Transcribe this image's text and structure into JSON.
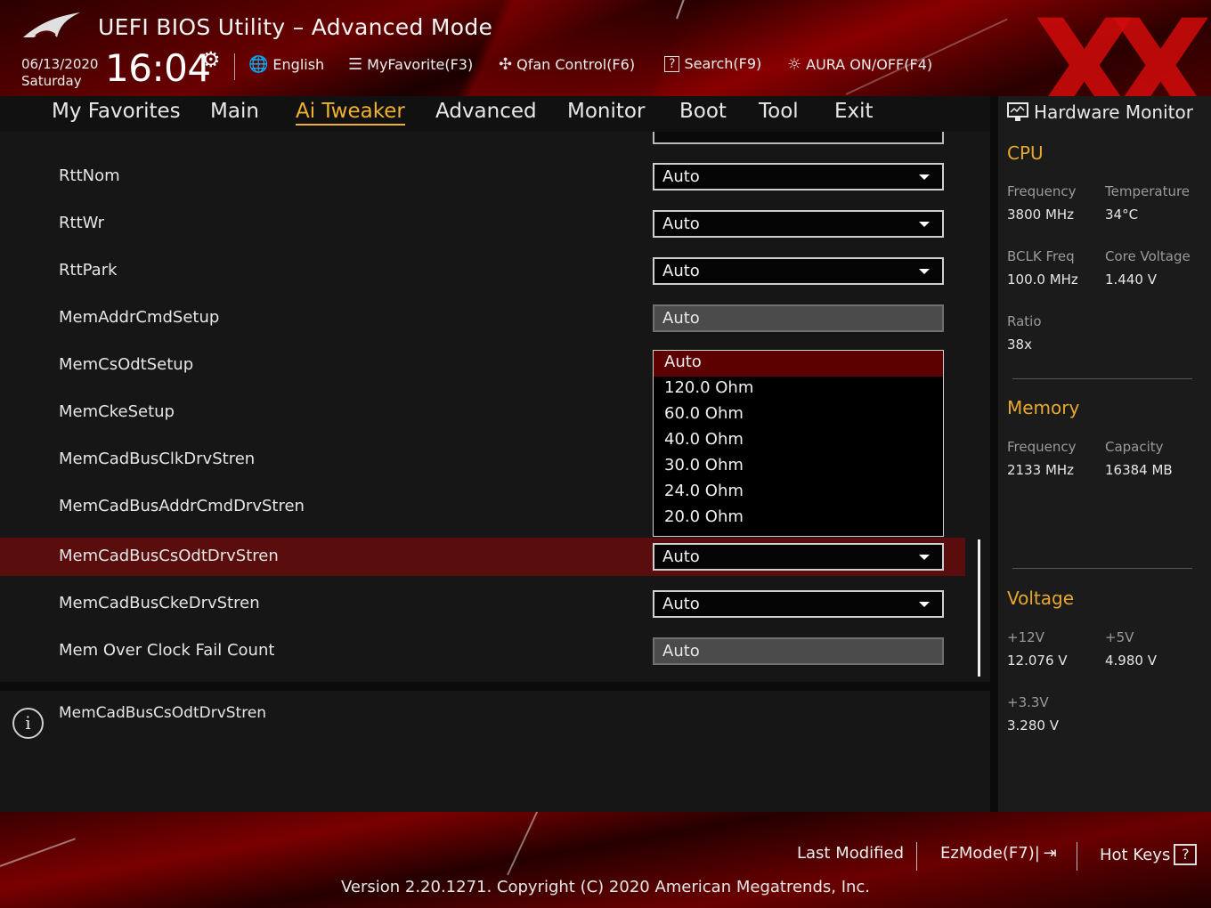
{
  "header": {
    "title": "UEFI BIOS Utility – Advanced Mode",
    "date": "06/13/2020",
    "day": "Saturday",
    "time": "16:04",
    "toolbar": [
      {
        "label": "English",
        "icon": "globe-icon"
      },
      {
        "label": "MyFavorite(F3)",
        "icon": "favorite-list-icon"
      },
      {
        "label": "Qfan Control(F6)",
        "icon": "fan-icon"
      },
      {
        "label": "Search(F9)",
        "icon": "search-help-icon"
      },
      {
        "label": "AURA ON/OFF(F4)",
        "icon": "aura-light-icon"
      }
    ]
  },
  "nav": {
    "tabs": [
      "My Favorites",
      "Main",
      "Ai Tweaker",
      "Advanced",
      "Monitor",
      "Boot",
      "Tool",
      "Exit"
    ],
    "active": "Ai Tweaker"
  },
  "settings": [
    {
      "label": "RttNom",
      "value": "Auto",
      "type": "dropdown"
    },
    {
      "label": "RttWr",
      "value": "Auto",
      "type": "dropdown"
    },
    {
      "label": "RttPark",
      "value": "Auto",
      "type": "dropdown"
    },
    {
      "label": "MemAddrCmdSetup",
      "value": "Auto",
      "type": "field"
    },
    {
      "label": "MemCsOdtSetup",
      "value": "",
      "type": "hidden"
    },
    {
      "label": "MemCkeSetup",
      "value": "",
      "type": "hidden"
    },
    {
      "label": "MemCadBusClkDrvStren",
      "value": "",
      "type": "hidden"
    },
    {
      "label": "MemCadBusAddrCmdDrvStren",
      "value": "",
      "type": "hidden"
    },
    {
      "label": "MemCadBusCsOdtDrvStren",
      "value": "Auto",
      "type": "dropdown",
      "selected": true
    },
    {
      "label": "MemCadBusCkeDrvStren",
      "value": "Auto",
      "type": "dropdown"
    },
    {
      "label": "Mem Over Clock Fail Count",
      "value": "Auto",
      "type": "field"
    }
  ],
  "dropdown_options": [
    "Auto",
    "120.0 Ohm",
    "60.0 Ohm",
    "40.0 Ohm",
    "30.0 Ohm",
    "24.0 Ohm",
    "20.0 Ohm"
  ],
  "dropdown_highlighted": "Auto",
  "help": {
    "text": "MemCadBusCsOdtDrvStren"
  },
  "hardware_monitor": {
    "title": "Hardware Monitor",
    "cpu": {
      "heading": "CPU",
      "frequency_label": "Frequency",
      "frequency": "3800 MHz",
      "temperature_label": "Temperature",
      "temperature": "34°C",
      "bclk_label": "BCLK Freq",
      "bclk": "100.0 MHz",
      "core_voltage_label": "Core Voltage",
      "core_voltage": "1.440 V",
      "ratio_label": "Ratio",
      "ratio": "38x"
    },
    "memory": {
      "heading": "Memory",
      "frequency_label": "Frequency",
      "frequency": "2133 MHz",
      "capacity_label": "Capacity",
      "capacity": "16384 MB"
    },
    "voltage": {
      "heading": "Voltage",
      "v12_label": "+12V",
      "v12": "12.076 V",
      "v5_label": "+5V",
      "v5": "4.980 V",
      "v33_label": "+3.3V",
      "v33": "3.280 V"
    }
  },
  "footer": {
    "last_modified": "Last Modified",
    "ezmode": "EzMode(F7)|",
    "hotkeys": "Hot Keys",
    "hotkeys_key": "?",
    "version": "Version 2.20.1271. Copyright (C) 2020 American Megatrends, Inc."
  },
  "colors": {
    "accent": "#f0b030",
    "selected_row": "#5a0d0d",
    "monitor_heading": "#e8a830",
    "brand_red": "#c00000"
  }
}
